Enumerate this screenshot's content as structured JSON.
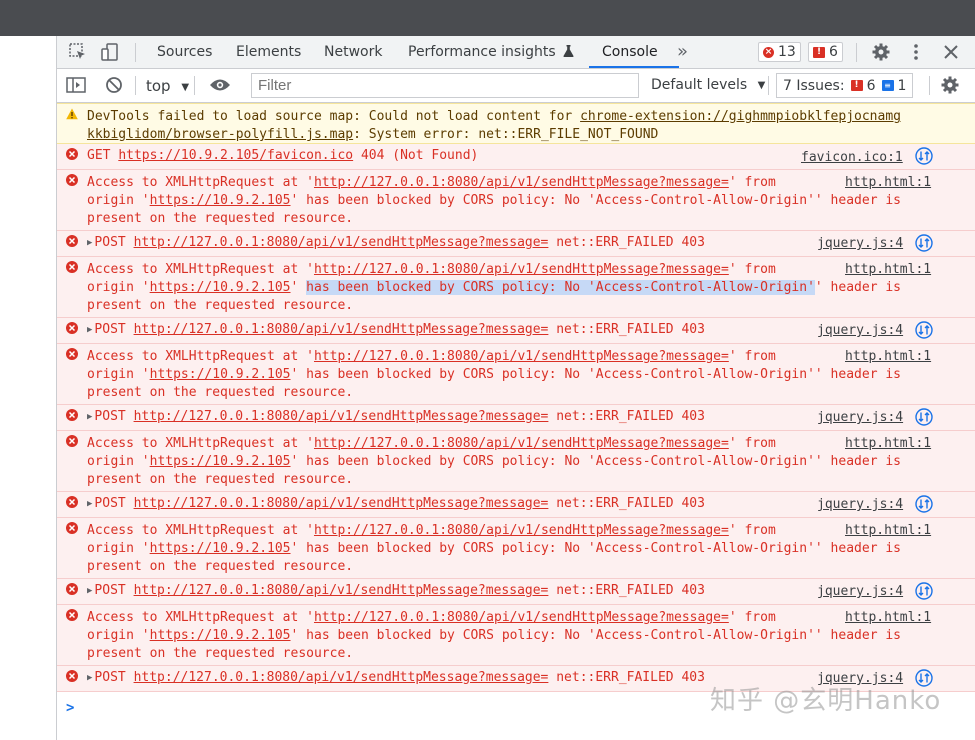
{
  "tabs": [
    {
      "label": "Sources"
    },
    {
      "label": "Elements"
    },
    {
      "label": "Network"
    },
    {
      "label": "Performance insights"
    },
    {
      "label": "Console"
    }
  ],
  "badges": {
    "errors": "13",
    "warnings": "6"
  },
  "toolbar": {
    "context": "top",
    "filter_placeholder": "Filter",
    "levels_label": "Default levels",
    "issues_label": "7 Issues:",
    "issues_errors": "6",
    "issues_info": "1"
  },
  "colors": {
    "error": "#d93025",
    "accent": "#1a73e8",
    "error_bg": "#fdf0f0",
    "warning_bg": "#fffbe5"
  },
  "warning": {
    "prefix": "DevTools failed to load source map: Could not load content for ",
    "url_line1": "chrome-extension://gighmmpiobklfepjocnamg",
    "url_line2": "kkbiglidom/browser-polyfill.js.map",
    "suffix": ": System error: net::ERR_FILE_NOT_FOUND"
  },
  "get_error": {
    "method": "GET",
    "url": "https://10.9.2.105/favicon.ico",
    "status": "404 (Not Found)",
    "source": "favicon.ico:1"
  },
  "cors": {
    "prefix": "Access to XMLHttpRequest at '",
    "url": "http://127.0.0.1:8080/api/v1/sendHttpMessage?message=",
    "from": "' from",
    "origin_prefix": "origin '",
    "origin": "https://10.9.2.105",
    "policy": "has been blocked by CORS policy: No 'Access-Control-Allow-Origin'",
    "header_is": "' header is",
    "line3": "present on the requested resource.",
    "source": "http.html:1"
  },
  "post": {
    "method": "POST",
    "url": "http://127.0.0.1:8080/api/v1/sendHttpMessage?message=",
    "status": "net::ERR_FAILED 403",
    "source": "jquery.js:4"
  },
  "prompt": ">",
  "watermark": "知乎 @玄明Hanko"
}
